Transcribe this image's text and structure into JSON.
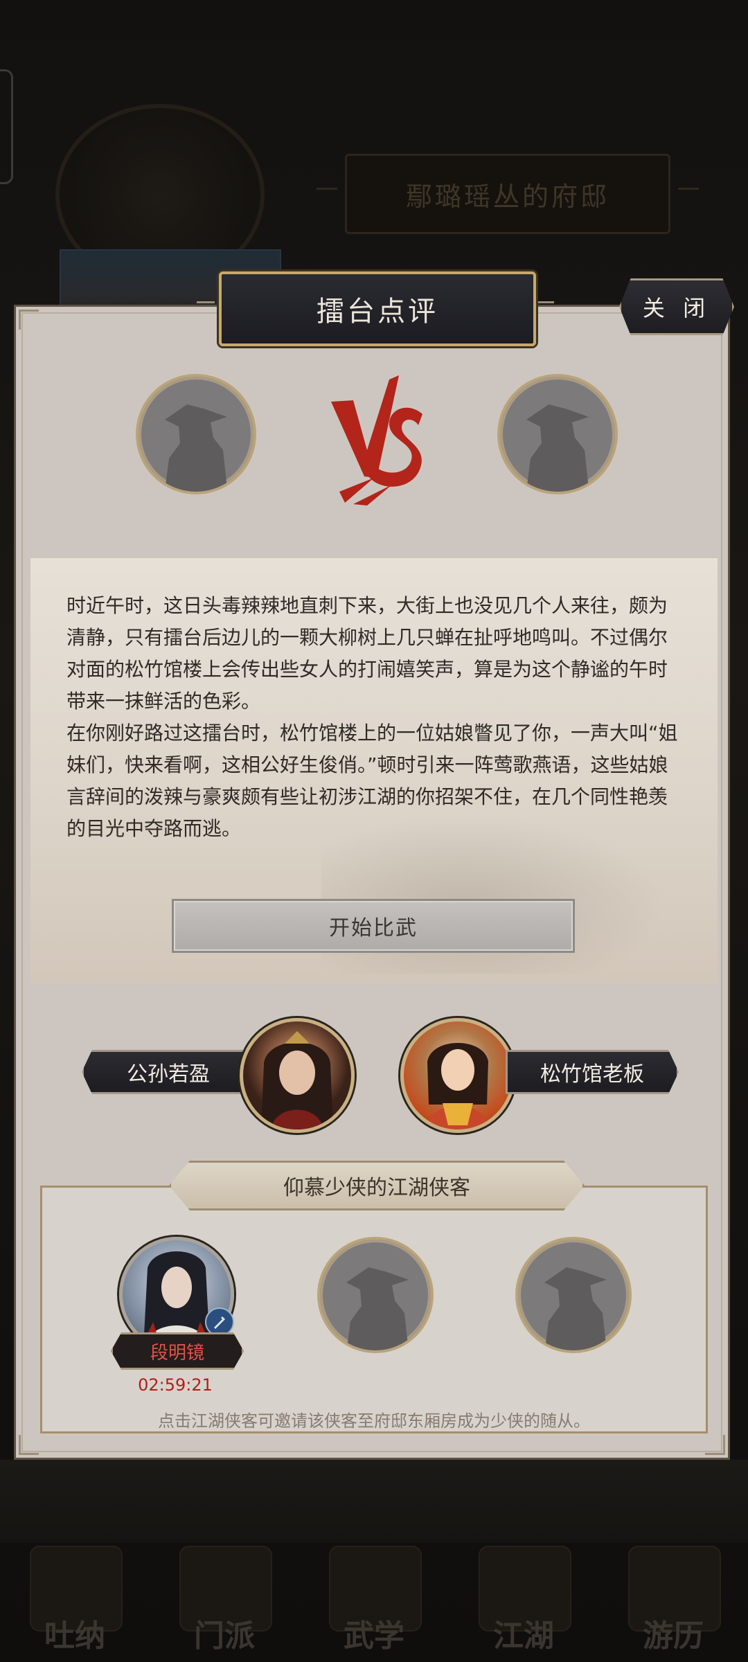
{
  "background": {
    "residence_title": "鄢璐瑶丛的府邸",
    "bottom_nav": [
      {
        "label": "吐纳",
        "icon": "breathing-icon"
      },
      {
        "label": "门派",
        "icon": "sect-icon"
      },
      {
        "label": "武学",
        "icon": "martial-arts-icon"
      },
      {
        "label": "江湖",
        "icon": "jianghu-icon"
      },
      {
        "label": "游历",
        "icon": "travel-icon"
      }
    ]
  },
  "modal": {
    "title": "擂台点评",
    "close_label": "关 闭",
    "vs_label": "VS",
    "story": [
      "时近午时，这日头毒辣辣地直刺下来，大街上也没见几个人来往，颇为清静，只有擂台后边儿的一颗大柳树上几只蝉在扯呼地鸣叫。不过偶尔对面的松竹馆楼上会传出些女人的打闹嬉笑声，算是为这个静谧的午时带来一抹鲜活的色彩。",
      "在你刚好路过这擂台时，松竹馆楼上的一位姑娘瞥见了你，一声大叫“姐妹们，快来看啊，这相公好生俊俏。”顿时引来一阵莺歌燕语，这些姑娘言辞间的泼辣与豪爽颇有些让初涉江湖的你招架不住，在几个同性艳羡的目光中夺路而逃。"
    ],
    "start_button": "开始比武",
    "fighter_left": {
      "name": "公孙若盈"
    },
    "fighter_right": {
      "name": "松竹馆老板"
    },
    "knights": {
      "title": "仰慕少侠的江湖侠客",
      "slots": [
        {
          "name": "段明镜",
          "timer": "02:59:21",
          "filled": true
        },
        {
          "filled": false
        },
        {
          "filled": false
        }
      ],
      "hint": "点击江湖侠客可邀请该侠客至府邸东厢房成为少侠的随从。"
    },
    "colors": {
      "panel_bg": "#cdc6c0",
      "gold_border": "#c8a96a",
      "vs_red": "#b3241a",
      "timer_red": "#b01f16"
    }
  }
}
